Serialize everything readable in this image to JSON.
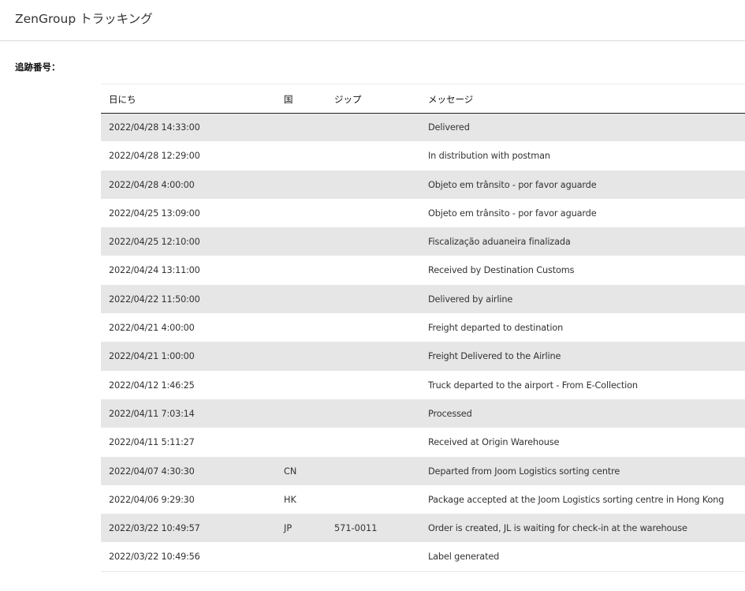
{
  "app": {
    "title": "ZenGroup トラッキング"
  },
  "tracking": {
    "label": "追跡番号："
  },
  "table": {
    "headers": {
      "date": "日にち",
      "country": "国",
      "zip": "ジップ",
      "message": "メッセージ"
    },
    "rows": [
      {
        "date": "2022/04/28 14:33:00",
        "country": "",
        "zip": "",
        "message": "Delivered"
      },
      {
        "date": "2022/04/28 12:29:00",
        "country": "",
        "zip": "",
        "message": "In distribution with postman"
      },
      {
        "date": "2022/04/28 4:00:00",
        "country": "",
        "zip": "",
        "message": "Objeto em trânsito - por favor aguarde"
      },
      {
        "date": "2022/04/25 13:09:00",
        "country": "",
        "zip": "",
        "message": "Objeto em trânsito - por favor aguarde"
      },
      {
        "date": "2022/04/25 12:10:00",
        "country": "",
        "zip": "",
        "message": "Fiscalização aduaneira finalizada"
      },
      {
        "date": "2022/04/24 13:11:00",
        "country": "",
        "zip": "",
        "message": "Received by Destination Customs"
      },
      {
        "date": "2022/04/22 11:50:00",
        "country": "",
        "zip": "",
        "message": "Delivered by airline"
      },
      {
        "date": "2022/04/21 4:00:00",
        "country": "",
        "zip": "",
        "message": "Freight departed to destination"
      },
      {
        "date": "2022/04/21 1:00:00",
        "country": "",
        "zip": "",
        "message": "Freight Delivered to the Airline"
      },
      {
        "date": "2022/04/12 1:46:25",
        "country": "",
        "zip": "",
        "message": "Truck departed to the airport - From E-Collection"
      },
      {
        "date": "2022/04/11 7:03:14",
        "country": "",
        "zip": "",
        "message": "Processed"
      },
      {
        "date": "2022/04/11 5:11:27",
        "country": "",
        "zip": "",
        "message": "Received at Origin Warehouse"
      },
      {
        "date": "2022/04/07 4:30:30",
        "country": "CN",
        "zip": "",
        "message": "Departed from Joom Logistics sorting centre"
      },
      {
        "date": "2022/04/06 9:29:30",
        "country": "HK",
        "zip": "",
        "message": "Package accepted at the Joom Logistics sorting centre in Hong Kong"
      },
      {
        "date": "2022/03/22 10:49:57",
        "country": "JP",
        "zip": "571-0011",
        "message": "Order is created, JL is waiting for check-in at the warehouse"
      },
      {
        "date": "2022/03/22 10:49:56",
        "country": "",
        "zip": "",
        "message": "Label generated"
      }
    ]
  }
}
